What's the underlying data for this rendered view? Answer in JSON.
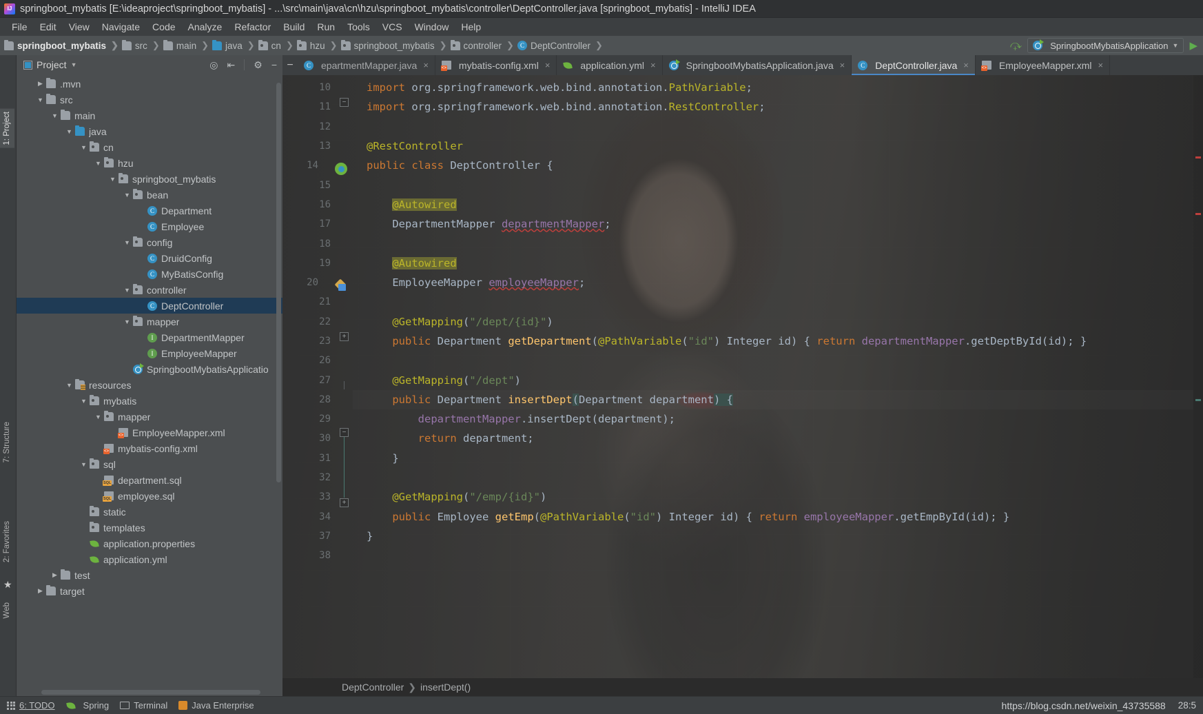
{
  "window": {
    "title": "springboot_mybatis [E:\\ideaproject\\springboot_mybatis] - ...\\src\\main\\java\\cn\\hzu\\springboot_mybatis\\controller\\DeptController.java [springboot_mybatis] - IntelliJ IDEA",
    "app_icon": "intellij-idea-icon"
  },
  "menubar": {
    "items": [
      "File",
      "Edit",
      "View",
      "Navigate",
      "Code",
      "Analyze",
      "Refactor",
      "Build",
      "Run",
      "Tools",
      "VCS",
      "Window",
      "Help"
    ]
  },
  "navbar": {
    "crumbs": [
      {
        "label": "springboot_mybatis",
        "icon": "module-icon"
      },
      {
        "label": "src",
        "icon": "folder-icon"
      },
      {
        "label": "main",
        "icon": "folder-icon"
      },
      {
        "label": "java",
        "icon": "source-folder-icon"
      },
      {
        "label": "cn",
        "icon": "package-icon"
      },
      {
        "label": "hzu",
        "icon": "package-icon"
      },
      {
        "label": "springboot_mybatis",
        "icon": "package-icon"
      },
      {
        "label": "controller",
        "icon": "package-icon"
      },
      {
        "label": "DeptController",
        "icon": "class-icon"
      }
    ],
    "build_icon": "build-hammer-icon",
    "run_configuration": "SpringbootMybatisApplication",
    "run_config_icon": "spring-boot-icon",
    "dropdown_icon": "chevron-down-icon",
    "run_icon": "run-play-icon"
  },
  "project_panel": {
    "title": "Project",
    "title_dropdown_icon": "chevron-down-icon",
    "toolbar_icons": [
      "locate-target-icon",
      "collapse-all-icon",
      "settings-gear-icon",
      "hide-panel-icon"
    ],
    "tree": [
      {
        "label": ".mvn",
        "indent": 1,
        "arrow": "collapsed",
        "icon": "folder-icon"
      },
      {
        "label": "src",
        "indent": 1,
        "arrow": "expanded",
        "icon": "folder-icon"
      },
      {
        "label": "main",
        "indent": 2,
        "arrow": "expanded",
        "icon": "folder-icon"
      },
      {
        "label": "java",
        "indent": 3,
        "arrow": "expanded",
        "icon": "source-folder-icon"
      },
      {
        "label": "cn",
        "indent": 4,
        "arrow": "expanded",
        "icon": "package-icon"
      },
      {
        "label": "hzu",
        "indent": 5,
        "arrow": "expanded",
        "icon": "package-icon"
      },
      {
        "label": "springboot_mybatis",
        "indent": 6,
        "arrow": "expanded",
        "icon": "package-icon"
      },
      {
        "label": "bean",
        "indent": 7,
        "arrow": "expanded",
        "icon": "package-icon"
      },
      {
        "label": "Department",
        "indent": 8,
        "arrow": "none",
        "icon": "class-icon"
      },
      {
        "label": "Employee",
        "indent": 8,
        "arrow": "none",
        "icon": "class-icon"
      },
      {
        "label": "config",
        "indent": 7,
        "arrow": "expanded",
        "icon": "package-icon"
      },
      {
        "label": "DruidConfig",
        "indent": 8,
        "arrow": "none",
        "icon": "class-icon"
      },
      {
        "label": "MyBatisConfig",
        "indent": 8,
        "arrow": "none",
        "icon": "class-icon"
      },
      {
        "label": "controller",
        "indent": 7,
        "arrow": "expanded",
        "icon": "package-icon"
      },
      {
        "label": "DeptController",
        "indent": 8,
        "arrow": "none",
        "icon": "class-icon",
        "selected": true
      },
      {
        "label": "mapper",
        "indent": 7,
        "arrow": "expanded",
        "icon": "package-icon"
      },
      {
        "label": "DepartmentMapper",
        "indent": 8,
        "arrow": "none",
        "icon": "interface-icon"
      },
      {
        "label": "EmployeeMapper",
        "indent": 8,
        "arrow": "none",
        "icon": "interface-icon"
      },
      {
        "label": "SpringbootMybatisApplicatio",
        "indent": 7,
        "arrow": "none",
        "icon": "spring-boot-app-icon"
      },
      {
        "label": "resources",
        "indent": 3,
        "arrow": "expanded",
        "icon": "resources-folder-icon"
      },
      {
        "label": "mybatis",
        "indent": 4,
        "arrow": "expanded",
        "icon": "package-icon"
      },
      {
        "label": "mapper",
        "indent": 5,
        "arrow": "expanded",
        "icon": "package-icon"
      },
      {
        "label": "EmployeeMapper.xml",
        "indent": 6,
        "arrow": "none",
        "icon": "xml-file-icon"
      },
      {
        "label": "mybatis-config.xml",
        "indent": 5,
        "arrow": "none",
        "icon": "xml-file-icon"
      },
      {
        "label": "sql",
        "indent": 4,
        "arrow": "expanded",
        "icon": "package-icon"
      },
      {
        "label": "department.sql",
        "indent": 5,
        "arrow": "none",
        "icon": "sql-file-icon"
      },
      {
        "label": "employee.sql",
        "indent": 5,
        "arrow": "none",
        "icon": "sql-file-icon"
      },
      {
        "label": "static",
        "indent": 4,
        "arrow": "none",
        "icon": "package-icon"
      },
      {
        "label": "templates",
        "indent": 4,
        "arrow": "none",
        "icon": "package-icon"
      },
      {
        "label": "application.properties",
        "indent": 4,
        "arrow": "none",
        "icon": "spring-leaf-icon"
      },
      {
        "label": "application.yml",
        "indent": 4,
        "arrow": "none",
        "icon": "spring-leaf-icon"
      },
      {
        "label": "test",
        "indent": 2,
        "arrow": "collapsed",
        "icon": "folder-icon"
      },
      {
        "label": "target",
        "indent": 1,
        "arrow": "collapsed",
        "icon": "folder-orange-icon"
      }
    ]
  },
  "left_toolwindow_tabs": [
    {
      "label": "1: Project",
      "active": true
    },
    {
      "label": "7: Structure",
      "active": false
    },
    {
      "label": "2: Favorites",
      "active": false
    },
    {
      "label": "Web",
      "active": false
    }
  ],
  "editor": {
    "tabs": [
      {
        "label": "epartmentMapper.java",
        "icon": "java-class-icon",
        "active": false,
        "truncated": true
      },
      {
        "label": "mybatis-config.xml",
        "icon": "xml-file-icon",
        "active": false
      },
      {
        "label": "application.yml",
        "icon": "spring-leaf-icon",
        "active": false
      },
      {
        "label": "SpringbootMybatisApplication.java",
        "icon": "spring-boot-app-icon",
        "active": false
      },
      {
        "label": "DeptController.java",
        "icon": "class-icon",
        "active": true
      },
      {
        "label": "EmployeeMapper.xml",
        "icon": "xml-file-icon",
        "active": false
      }
    ],
    "close_icon": "close-icon",
    "hide_icon": "minimize-icon",
    "line_numbers": [
      "10",
      "11",
      "12",
      "13",
      "14",
      "15",
      "16",
      "17",
      "18",
      "19",
      "20",
      "21",
      "22",
      "23",
      "26",
      "27",
      "28",
      "29",
      "30",
      "31",
      "32",
      "33",
      "34",
      "37",
      "38"
    ],
    "lines": [
      {
        "n": "10",
        "tokens": [
          {
            "t": "import ",
            "c": "k"
          },
          {
            "t": "org.springframework.web.bind.annotation.",
            "c": "t"
          },
          {
            "t": "PathVariable",
            "c": "an"
          },
          {
            "t": ";",
            "c": "t"
          }
        ]
      },
      {
        "n": "11",
        "tokens": [
          {
            "t": "import ",
            "c": "k"
          },
          {
            "t": "org.springframework.web.bind.annotation.",
            "c": "t"
          },
          {
            "t": "RestController",
            "c": "an"
          },
          {
            "t": ";",
            "c": "t"
          }
        ]
      },
      {
        "n": "12",
        "tokens": []
      },
      {
        "n": "13",
        "tokens": [
          {
            "t": "@RestController",
            "c": "an"
          }
        ]
      },
      {
        "n": "14",
        "tokens": [
          {
            "t": "public ",
            "c": "k"
          },
          {
            "t": "class ",
            "c": "k"
          },
          {
            "t": "DeptController ",
            "c": "t"
          },
          {
            "t": "{",
            "c": "t"
          }
        ]
      },
      {
        "n": "15",
        "tokens": []
      },
      {
        "n": "16",
        "tokens": [
          {
            "t": "    ",
            "c": "t"
          },
          {
            "t": "@Autowired",
            "c": "anh"
          }
        ]
      },
      {
        "n": "17",
        "tokens": [
          {
            "t": "    DepartmentMapper ",
            "c": "t"
          },
          {
            "t": "departmentMapper",
            "c": "fld err"
          },
          {
            "t": ";",
            "c": "t"
          }
        ]
      },
      {
        "n": "18",
        "tokens": []
      },
      {
        "n": "19",
        "tokens": [
          {
            "t": "    ",
            "c": "t"
          },
          {
            "t": "@Autowired",
            "c": "anh"
          }
        ]
      },
      {
        "n": "20",
        "tokens": [
          {
            "t": "    EmployeeMapper ",
            "c": "t"
          },
          {
            "t": "employeeMapper",
            "c": "fld err"
          },
          {
            "t": ";",
            "c": "t"
          }
        ]
      },
      {
        "n": "21",
        "tokens": []
      },
      {
        "n": "22",
        "tokens": [
          {
            "t": "    ",
            "c": "t"
          },
          {
            "t": "@GetMapping",
            "c": "an"
          },
          {
            "t": "(",
            "c": "t"
          },
          {
            "t": "\"/dept/{id}\"",
            "c": "s"
          },
          {
            "t": ")",
            "c": "t"
          }
        ]
      },
      {
        "n": "23",
        "tokens": [
          {
            "t": "    ",
            "c": "t"
          },
          {
            "t": "public ",
            "c": "k"
          },
          {
            "t": "Department ",
            "c": "t"
          },
          {
            "t": "getDepartment",
            "c": "f"
          },
          {
            "t": "(",
            "c": "t"
          },
          {
            "t": "@PathVariable",
            "c": "an"
          },
          {
            "t": "(",
            "c": "t"
          },
          {
            "t": "\"id\"",
            "c": "s"
          },
          {
            "t": ") Integer id) { ",
            "c": "t"
          },
          {
            "t": "return ",
            "c": "k"
          },
          {
            "t": "departmentMapper",
            "c": "fld"
          },
          {
            "t": ".getDeptById(id); }",
            "c": "t"
          }
        ]
      },
      {
        "n": "26",
        "tokens": []
      },
      {
        "n": "27",
        "tokens": [
          {
            "t": "    ",
            "c": "t"
          },
          {
            "t": "@GetMapping",
            "c": "an"
          },
          {
            "t": "(",
            "c": "t"
          },
          {
            "t": "\"/dept\"",
            "c": "s"
          },
          {
            "t": ")",
            "c": "t"
          }
        ]
      },
      {
        "n": "28",
        "tokens": [
          {
            "t": "    ",
            "c": "t"
          },
          {
            "t": "public ",
            "c": "k"
          },
          {
            "t": "Department ",
            "c": "t"
          },
          {
            "t": "insertDept",
            "c": "f"
          },
          {
            "t": "(",
            "c": "t brhl"
          },
          {
            "t": "Department department",
            "c": "t"
          },
          {
            "t": ")",
            "c": "t brhl"
          },
          {
            "t": " {",
            "c": "t brhl"
          }
        ]
      },
      {
        "n": "29",
        "tokens": [
          {
            "t": "        ",
            "c": "t"
          },
          {
            "t": "departmentMapper",
            "c": "fld"
          },
          {
            "t": ".insertDept(department);",
            "c": "t"
          }
        ]
      },
      {
        "n": "30",
        "tokens": [
          {
            "t": "        ",
            "c": "t"
          },
          {
            "t": "return ",
            "c": "k"
          },
          {
            "t": "department;",
            "c": "t"
          }
        ]
      },
      {
        "n": "31",
        "tokens": [
          {
            "t": "    }",
            "c": "t"
          }
        ]
      },
      {
        "n": "32",
        "tokens": []
      },
      {
        "n": "33",
        "tokens": [
          {
            "t": "    ",
            "c": "t"
          },
          {
            "t": "@GetMapping",
            "c": "an"
          },
          {
            "t": "(",
            "c": "t"
          },
          {
            "t": "\"/emp/{id}\"",
            "c": "s"
          },
          {
            "t": ")",
            "c": "t"
          }
        ]
      },
      {
        "n": "34",
        "tokens": [
          {
            "t": "    ",
            "c": "t"
          },
          {
            "t": "public ",
            "c": "k"
          },
          {
            "t": "Employee ",
            "c": "t"
          },
          {
            "t": "getEmp",
            "c": "f"
          },
          {
            "t": "(",
            "c": "t"
          },
          {
            "t": "@PathVariable",
            "c": "an"
          },
          {
            "t": "(",
            "c": "t"
          },
          {
            "t": "\"id\"",
            "c": "s"
          },
          {
            "t": ") Integer id) { ",
            "c": "t"
          },
          {
            "t": "return ",
            "c": "k"
          },
          {
            "t": "employeeMapper",
            "c": "fld"
          },
          {
            "t": ".getEmpById(id); }",
            "c": "t"
          }
        ]
      },
      {
        "n": "37",
        "tokens": [
          {
            "t": "}",
            "c": "t"
          }
        ]
      },
      {
        "n": "38",
        "tokens": []
      }
    ],
    "gutter_icons": [
      {
        "line": "14",
        "icon": "spring-bean-gutter-icon"
      },
      {
        "line": "20",
        "icon": "spring-autowired-gutter-icon"
      }
    ],
    "breadcrumb": {
      "class": "DeptController",
      "method": "insertDept()",
      "separator_icon": "chevron-right-icon"
    }
  },
  "statusbar": {
    "items": [
      {
        "label": "6: TODO",
        "icon": "todo-grid-icon"
      },
      {
        "label": "Spring",
        "icon": "spring-leaf-icon"
      },
      {
        "label": "Terminal",
        "icon": "terminal-icon"
      },
      {
        "label": "Java Enterprise",
        "icon": "java-enterprise-icon"
      }
    ],
    "url": "https://blog.csdn.net/weixin_43735588",
    "caret_position": "28:5"
  },
  "colors": {
    "accent": "#3592c4",
    "spring_green": "#6db33f",
    "selection": "#1f3b55",
    "annotation": "#bbb529",
    "keyword": "#cc7832",
    "string": "#6a8759",
    "field": "#9876aa",
    "function": "#ffc66d",
    "plain_text": "#a9b7c6"
  }
}
